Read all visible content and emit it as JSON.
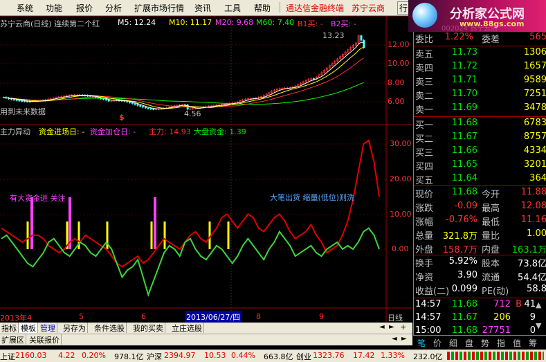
{
  "menu": {
    "items": [
      "系统",
      "功能",
      "报价",
      "分析",
      "扩展市场行情",
      "资讯",
      "工具",
      "帮助"
    ],
    "links": [
      "通达信金融终端",
      "苏宁云商"
    ],
    "trade": "行"
  },
  "logo": {
    "main": "分析家公式网",
    "url": "www.88gs.com",
    "faded": "002024 苏宁云商"
  },
  "price_chart": {
    "title": "苏宁云商(日线) 连续第二个红",
    "ma5": "M5: 12.24",
    "ma10": "M10: 11.17",
    "ma20": "M20: 9.68",
    "ma60": "M60: 7.40",
    "b1": "B1买: -",
    "b2": "B2买: -",
    "note": "用到未来数据",
    "high_label": "13.23",
    "low_label": "4.56",
    "yticks": [
      "12.00",
      "10.00",
      "8.00",
      "6.00"
    ]
  },
  "indicator_chart": {
    "title": "主力异动",
    "f1": "资金进场日: -",
    "f2": "资金加仓日: -",
    "f3": "主力: 14.93",
    "f4": "大盘资金: 1.39",
    "ann1": "有大资金进 关注",
    "ann2": "大笔出货 缩量(低位)则洗",
    "yticks": [
      "30.00",
      "20.00",
      "10.00",
      "0.00"
    ]
  },
  "time_axis": {
    "year": "2013年4",
    "m5": "5",
    "m6": "6",
    "cursor_date": "2013/06/27/四",
    "m8": "8",
    "m9": "9",
    "period": "日线"
  },
  "bottom_tabs": [
    "指标",
    "模板",
    "管理",
    "另存为",
    "条件选股",
    "我的买卖",
    "立庄选股"
  ],
  "bottom_tabs2": [
    "扩展区",
    "关联报价"
  ],
  "status": {
    "sh_label": "上证",
    "sh_value": "2160.03",
    "sh_change": "4.22",
    "sh_pct": "0.20%",
    "sh_amount": "978.1亿",
    "hs_label": "沪深",
    "hs_value": "2394.97",
    "hs_change": "10.53",
    "hs_pct": "0.44%",
    "hs_amount": "663.8亿",
    "cy_label": "创业",
    "cy_value": "1323.76",
    "cy_change": "17.42",
    "cy_pct": "1.33%",
    "cy_amount": "232.0亿"
  },
  "quote": {
    "weibi_label": "委比",
    "weibi": "1.22%",
    "weicha_label": "委差",
    "weicha": "565",
    "asks": [
      {
        "label": "卖五",
        "price": "11.73",
        "vol": "1306"
      },
      {
        "label": "卖四",
        "price": "11.72",
        "vol": "1657"
      },
      {
        "label": "卖三",
        "price": "11.71",
        "vol": "9589"
      },
      {
        "label": "卖二",
        "price": "11.70",
        "vol": "7251"
      },
      {
        "label": "卖一",
        "price": "11.69",
        "vol": "3478"
      }
    ],
    "bids": [
      {
        "label": "买一",
        "price": "11.68",
        "vol": "6783"
      },
      {
        "label": "买二",
        "price": "11.67",
        "vol": "8757"
      },
      {
        "label": "买三",
        "price": "11.66",
        "vol": "4334"
      },
      {
        "label": "买四",
        "price": "11.65",
        "vol": "3201"
      },
      {
        "label": "买五",
        "price": "11.64",
        "vol": "364"
      }
    ],
    "stats": [
      {
        "l1": "现价",
        "v1": "11.68",
        "l2": "今开",
        "v2": "11.88"
      },
      {
        "l1": "涨跌",
        "v1": "-0.09",
        "l2": "最高",
        "v2": "12.08"
      },
      {
        "l1": "涨幅",
        "v1": "-0.76%",
        "l2": "最低",
        "v2": "11.16"
      },
      {
        "l1": "总量",
        "v1": "321.8万",
        "l2": "量比",
        "v2": "1.00"
      },
      {
        "l1": "外盘",
        "v1": "158.7万",
        "l2": "内盘",
        "v2": "163.1万"
      }
    ],
    "stats2": [
      {
        "l1": "换手",
        "v1": "5.92%",
        "l2": "股本",
        "v2": "73.8亿"
      },
      {
        "l1": "净资",
        "v1": "3.90",
        "l2": "流通",
        "v2": "54.4亿"
      },
      {
        "l1": "收益(二)",
        "v1": "0.099",
        "l2": "PE(动)",
        "v2": "58.8"
      }
    ],
    "ticks": [
      {
        "time": "14:57",
        "price": "11.68",
        "vol": "712",
        "dir": "B",
        "n": "41"
      },
      {
        "time": "14:57",
        "price": "11.67",
        "vol": "206",
        "dir": "",
        "n": "9"
      },
      {
        "time": "15:00",
        "price": "11.68",
        "vol": "27751",
        "dir": "",
        "n": "0"
      }
    ]
  },
  "right_tabs": [
    "笔",
    "价",
    "细",
    "盘",
    "势",
    "指",
    "值",
    "筹"
  ],
  "colors": {
    "up": "#ff3232",
    "down": "#00e600",
    "ma5": "#ffffff",
    "ma10": "#ffff00",
    "ma20": "#ff40ff",
    "ma60": "#00ff00",
    "main_line": "#e00000",
    "market_line": "#3ad83a",
    "grid": "#8b0000"
  }
}
